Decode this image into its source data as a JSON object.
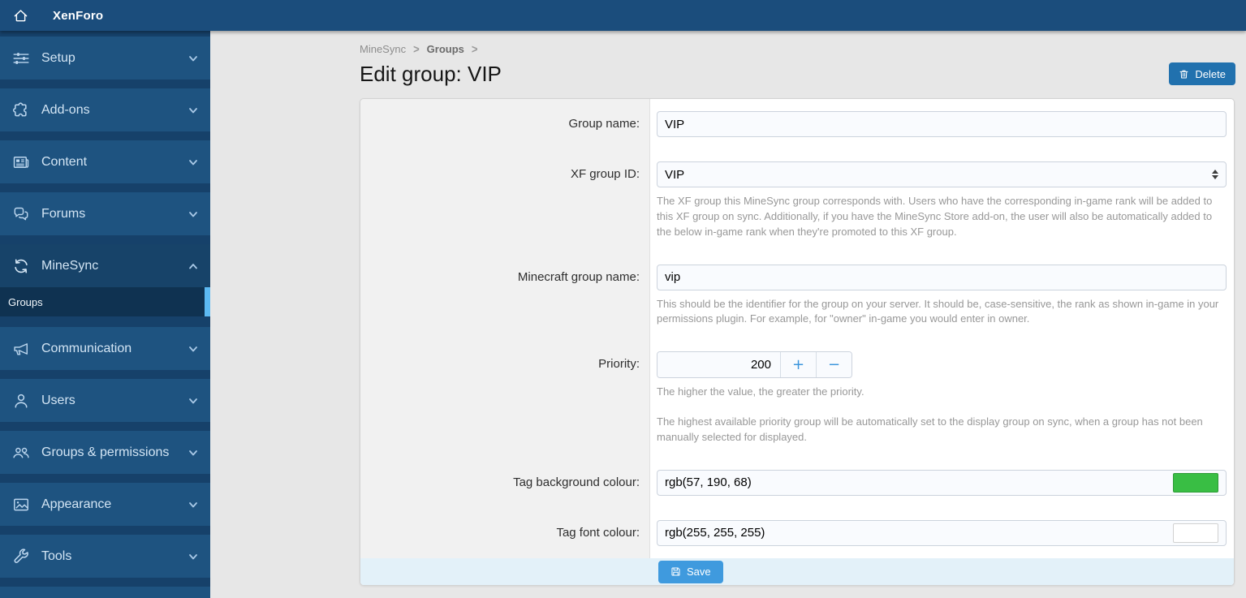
{
  "topbar": {
    "app_title": "XenForo"
  },
  "sidebar": {
    "items": [
      {
        "label": "Setup",
        "icon": "sliders-icon"
      },
      {
        "label": "Add-ons",
        "icon": "puzzle-icon"
      },
      {
        "label": "Content",
        "icon": "newspaper-icon"
      },
      {
        "label": "Forums",
        "icon": "chat-bubbles-icon"
      },
      {
        "label": "MineSync",
        "icon": "sync-icon",
        "expanded": true,
        "children": [
          {
            "label": "Groups",
            "selected": true
          }
        ]
      },
      {
        "label": "Communication",
        "icon": "megaphone-icon"
      },
      {
        "label": "Users",
        "icon": "user-icon"
      },
      {
        "label": "Groups & permissions",
        "icon": "people-icon"
      },
      {
        "label": "Appearance",
        "icon": "image-icon"
      },
      {
        "label": "Tools",
        "icon": "wrench-icon"
      }
    ]
  },
  "breadcrumb": {
    "item1": "MineSync",
    "item2": "Groups"
  },
  "page": {
    "title": "Edit group: VIP"
  },
  "actions": {
    "delete_label": "Delete",
    "save_label": "Save"
  },
  "form": {
    "group_name": {
      "label": "Group name:",
      "value": "VIP"
    },
    "xf_group_id": {
      "label": "XF group ID:",
      "value": "VIP",
      "help": "The XF group this MineSync group corresponds with. Users who have the corresponding in-game rank will be added to this XF group on sync. Additionally, if you have the MineSync Store add-on, the user will also be automatically added to the below in-game rank when they're promoted to this XF group."
    },
    "minecraft_group_name": {
      "label": "Minecraft group name:",
      "value": "vip",
      "help": "This should be the identifier for the group on your server. It should be, case-sensitive, the rank as shown in-game in your permissions plugin. For example, for \"owner\" in-game you would enter in owner."
    },
    "priority": {
      "label": "Priority:",
      "value": "200",
      "increment_label": "+",
      "decrement_label": "−",
      "help_1": "The higher the value, the greater the priority.",
      "help_2": "The highest available priority group will be automatically set to the display group on sync, when a group has not been manually selected for displayed."
    },
    "tag_background_colour": {
      "label": "Tag background colour:",
      "value": "rgb(57, 190, 68)",
      "swatch": "#39be44"
    },
    "tag_font_colour": {
      "label": "Tag font colour:",
      "value": "rgb(255, 255, 255)",
      "swatch": "#ffffff"
    }
  },
  "colors": {
    "delete_button": "#2171ae",
    "save_button": "#3f9ade",
    "selected_indicator": "#5cb9f2",
    "tag_background_swatch": "#39be44",
    "tag_font_swatch": "#ffffff"
  }
}
